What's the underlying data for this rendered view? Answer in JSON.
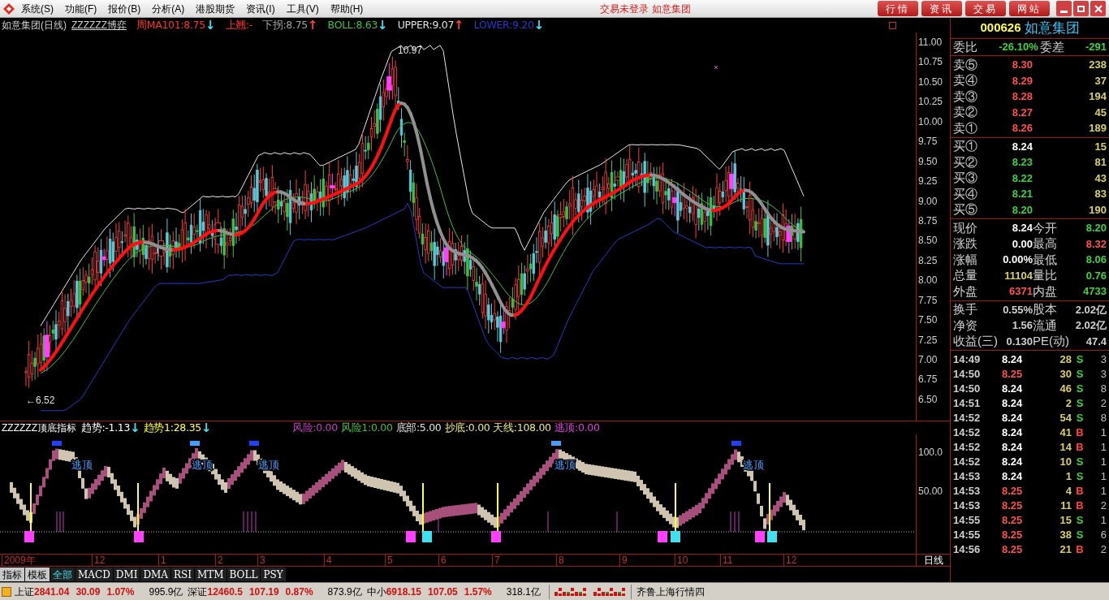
{
  "title_bar": {
    "menu": [
      "系统(S)",
      "功能(F)",
      "报价(B)",
      "分析(A)",
      "港股期货",
      "资讯(I)",
      "工具(V)",
      "帮助(H)"
    ],
    "title": "交易未登录  如意集团",
    "buttons": [
      "行情",
      "资讯",
      "交易",
      "网站"
    ]
  },
  "chart": {
    "title": "如意集团(日线)",
    "formula": "ZZZZZZ博弈",
    "legend": [
      {
        "text": "周MA101:8.75",
        "color": "#ff3232",
        "arrow": {
          "text": "↓",
          "color": "#40e0f0"
        }
      },
      {
        "text": "上翘:-",
        "color": "#ff3232"
      },
      {
        "text": "下拐:8.75",
        "color": "#a0a0a0",
        "arrow": {
          "text": "↑",
          "color": "#ff4040"
        }
      },
      {
        "text": "BOLL:8.63",
        "color": "#40c040",
        "arrow": {
          "text": "↓",
          "color": "#40e0f0"
        }
      },
      {
        "text": "UPPER:9.07",
        "color": "#e0e0e0",
        "arrow": {
          "text": "↑",
          "color": "#ff4040"
        }
      },
      {
        "text": "LOWER:9.20",
        "color": "#2838c8",
        "arrow": {
          "text": "↓",
          "color": "#40e0f0"
        }
      }
    ],
    "y_axis": [
      "11.00",
      "10.75",
      "10.50",
      "10.25",
      "10.00",
      "9.75",
      "9.50",
      "9.25",
      "9.00",
      "8.75",
      "8.50",
      "8.25",
      "8.00",
      "7.75",
      "7.50",
      "7.25",
      "7.00",
      "6.75",
      "6.50"
    ],
    "high_label": "10.97",
    "low_label": "←6.52"
  },
  "indicator": {
    "name": "ZZZZZZ顶底指标",
    "legend": [
      {
        "text": "趋势:-1.13",
        "color": "#ffffff",
        "arrow": {
          "text": "↓",
          "color": "#40e0f0"
        }
      },
      {
        "text": "趋势1:28.35",
        "color": "#ffff40",
        "arrow": {
          "text": "↓",
          "color": "#40e0f0"
        }
      },
      {
        "text": "风险:0.00",
        "color": "#c040c0"
      },
      {
        "text": "风险1:0.00",
        "color": "#40c040"
      },
      {
        "text": "底部:5.00",
        "color": "#e0e0e0"
      },
      {
        "text": "抄底:0.00",
        "color": "#e8e880"
      },
      {
        "text": "天线:108.00",
        "color": "#e8e880"
      },
      {
        "text": "逃顶:0.00",
        "color": "#e040e0"
      }
    ],
    "y_axis": [
      "100.0",
      "50.00"
    ],
    "signals": [
      "逃顶",
      "逃顶",
      "逃顶",
      "逃顶",
      "逃顶"
    ]
  },
  "date_axis": {
    "labels": [
      "2009年",
      "12",
      "1",
      "2",
      "3",
      "4",
      "5",
      "6",
      "7",
      "8",
      "9",
      "10",
      "11",
      "12"
    ],
    "period": "日线"
  },
  "tabs": [
    {
      "label": "指标",
      "kind": "button",
      "selected": false
    },
    {
      "label": "模板",
      "kind": "button",
      "selected": false
    },
    {
      "label": "全部",
      "kind": "tab",
      "selected": true
    },
    {
      "label": "MACD",
      "kind": "tab",
      "selected": false
    },
    {
      "label": "DMI",
      "kind": "tab",
      "selected": false
    },
    {
      "label": "DMA",
      "kind": "tab",
      "selected": false
    },
    {
      "label": "RSI",
      "kind": "tab",
      "selected": false
    },
    {
      "label": "MTM",
      "kind": "tab",
      "selected": false
    },
    {
      "label": "BOLL",
      "kind": "tab",
      "selected": false
    },
    {
      "label": "PSY",
      "kind": "tab",
      "selected": false
    }
  ],
  "quote": {
    "code": "000626",
    "name": "如意集团",
    "ratio": {
      "label": "委比",
      "value": "-26.10%",
      "diff_label": "委差",
      "diff": "-291",
      "color": "#40d040"
    },
    "asks": [
      {
        "label": "卖⑤",
        "price": "8.30",
        "color": "#ff5050",
        "volume": "238"
      },
      {
        "label": "卖④",
        "price": "8.29",
        "color": "#ff5050",
        "volume": "37"
      },
      {
        "label": "卖③",
        "price": "8.28",
        "color": "#ff5050",
        "volume": "194"
      },
      {
        "label": "卖②",
        "price": "8.27",
        "color": "#ff5050",
        "volume": "45"
      },
      {
        "label": "卖①",
        "price": "8.26",
        "color": "#ff5050",
        "volume": "189"
      }
    ],
    "bids": [
      {
        "label": "买①",
        "price": "8.24",
        "color": "#ffffff",
        "volume": "15"
      },
      {
        "label": "买②",
        "price": "8.23",
        "color": "#40d040",
        "volume": "81"
      },
      {
        "label": "买③",
        "price": "8.22",
        "color": "#40d040",
        "volume": "43"
      },
      {
        "label": "买④",
        "price": "8.21",
        "color": "#40d040",
        "volume": "83"
      },
      {
        "label": "买⑤",
        "price": "8.20",
        "color": "#40d040",
        "volume": "190"
      }
    ],
    "stats": [
      [
        {
          "label": "现价",
          "value": "8.24",
          "color": "#ffffff"
        },
        {
          "label": "今开",
          "value": "8.20",
          "color": "#40d040"
        }
      ],
      [
        {
          "label": "涨跌",
          "value": "0.00",
          "color": "#ffffff"
        },
        {
          "label": "最高",
          "value": "8.32",
          "color": "#ff5050"
        }
      ],
      [
        {
          "label": "涨幅",
          "value": "0.00%",
          "color": "#ffffff"
        },
        {
          "label": "最低",
          "value": "8.06",
          "color": "#40d040"
        }
      ],
      [
        {
          "label": "总量",
          "value": "11104",
          "color": "#d8d060"
        },
        {
          "label": "量比",
          "value": "0.76",
          "color": "#40d040"
        }
      ],
      [
        {
          "label": "外盘",
          "value": "6371",
          "color": "#ff5050"
        },
        {
          "label": "内盘",
          "value": "4733",
          "color": "#40d040"
        }
      ]
    ],
    "fundamentals": [
      [
        {
          "label": "换手",
          "value": "0.55%"
        },
        {
          "label": "股本",
          "value": "2.02亿"
        }
      ],
      [
        {
          "label": "净资",
          "value": "1.56"
        },
        {
          "label": "流通",
          "value": "2.02亿"
        }
      ],
      [
        {
          "label": "收益(三)",
          "value": "0.130"
        },
        {
          "label": "PE(动)",
          "value": "47.4"
        }
      ]
    ],
    "ticks": [
      {
        "time": "14:49",
        "price": "8.24",
        "color": "#ffffff",
        "volume": "28",
        "side": "S",
        "kind": "sell",
        "count": "3"
      },
      {
        "time": "14:50",
        "price": "8.25",
        "color": "#ff5050",
        "volume": "30",
        "side": "S",
        "kind": "sell",
        "count": "3"
      },
      {
        "time": "14:50",
        "price": "8.24",
        "color": "#ffffff",
        "volume": "46",
        "side": "S",
        "kind": "sell",
        "count": "8"
      },
      {
        "time": "14:51",
        "price": "8.24",
        "color": "#ffffff",
        "volume": "2",
        "side": "S",
        "kind": "sell",
        "count": "2"
      },
      {
        "time": "14:52",
        "price": "8.24",
        "color": "#ffffff",
        "volume": "54",
        "side": "S",
        "kind": "sell",
        "count": "8"
      },
      {
        "time": "14:52",
        "price": "8.24",
        "color": "#ffffff",
        "volume": "41",
        "side": "B",
        "kind": "buy",
        "count": "1"
      },
      {
        "time": "14:52",
        "price": "8.24",
        "color": "#ffffff",
        "volume": "14",
        "side": "B",
        "kind": "buy",
        "count": "1"
      },
      {
        "time": "14:52",
        "price": "8.24",
        "color": "#ffffff",
        "volume": "10",
        "side": "S",
        "kind": "sell",
        "count": "1"
      },
      {
        "time": "14:53",
        "price": "8.24",
        "color": "#ffffff",
        "volume": "1",
        "side": "S",
        "kind": "sell",
        "count": "1"
      },
      {
        "time": "14:53",
        "price": "8.25",
        "color": "#ff5050",
        "volume": "4",
        "side": "B",
        "kind": "buy",
        "count": "1"
      },
      {
        "time": "14:53",
        "price": "8.25",
        "color": "#ff5050",
        "volume": "11",
        "side": "B",
        "kind": "buy",
        "count": "2"
      },
      {
        "time": "14:55",
        "price": "8.25",
        "color": "#ff5050",
        "volume": "15",
        "side": "S",
        "kind": "sell",
        "count": "1"
      },
      {
        "time": "14:55",
        "price": "8.25",
        "color": "#ff5050",
        "volume": "38",
        "side": "S",
        "kind": "sell",
        "count": "6"
      },
      {
        "time": "14:56",
        "price": "8.25",
        "color": "#ff5050",
        "volume": "21",
        "side": "B",
        "kind": "buy",
        "count": "2"
      }
    ]
  },
  "status_bar": {
    "indices": [
      {
        "name": "上证",
        "value": "2841.04",
        "change": "30.09",
        "percent": "1.07%",
        "amount": "995.9亿"
      },
      {
        "name": "深证",
        "value": "12460.5",
        "change": "107.19",
        "percent": "0.87%",
        "amount": "873.9亿"
      },
      {
        "name": "中小",
        "value": "6918.15",
        "change": "107.05",
        "percent": "1.57%",
        "amount": "318.1亿"
      }
    ],
    "feed": "齐鲁上海行情四"
  }
}
